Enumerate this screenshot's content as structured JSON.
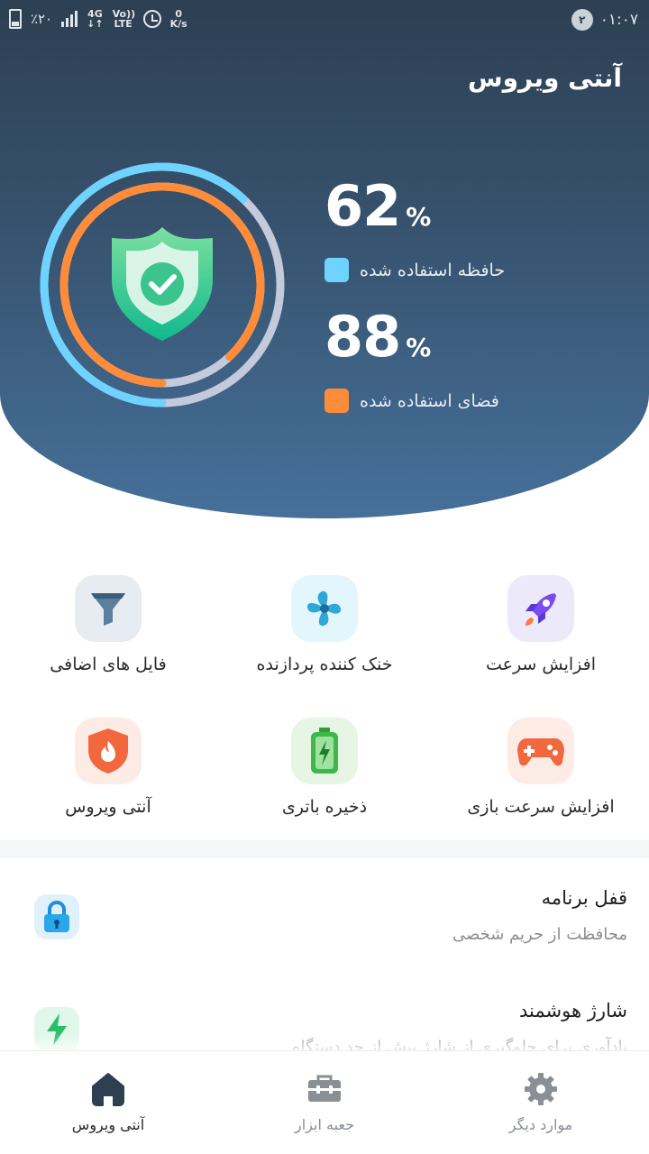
{
  "status_bar": {
    "battery_percent": "٪۲۰",
    "network_type": "4G",
    "volte": "Vo)) LTE",
    "speed_value": "0",
    "speed_unit": "K/s",
    "notification_count": "۲",
    "time": "۰۱:۰۷"
  },
  "header": {
    "title": "آنتی ویروس"
  },
  "stats": {
    "memory": {
      "value": "62",
      "unit": "%",
      "label": "حافظه استفاده شده",
      "color": "#6fd3ff",
      "fraction": 0.62
    },
    "storage": {
      "value": "88",
      "unit": "%",
      "label": "فضای استفاده شده",
      "color": "#ff8c3a",
      "fraction": 0.88
    }
  },
  "tools": [
    {
      "label": "افزایش سرعت",
      "icon": "rocket-icon"
    },
    {
      "label": "خنک کننده پردازنده",
      "icon": "fan-icon"
    },
    {
      "label": "فایل های اضافی",
      "icon": "funnel-icon"
    },
    {
      "label": "افزایش سرعت بازی",
      "icon": "gamepad-icon"
    },
    {
      "label": "ذخیره باتری",
      "icon": "battery-icon"
    },
    {
      "label": "آنتی ویروس",
      "icon": "shield-icon"
    }
  ],
  "list": [
    {
      "title": "قفل برنامه",
      "subtitle": "محافظت از حریم شخصی",
      "icon": "lock-icon"
    },
    {
      "title": "شارژ هوشمند",
      "subtitle": "یادآوری برای جلوگیری از شارژ بیش از حد دستگاه",
      "icon": "bolt-icon"
    }
  ],
  "bottom_nav": [
    {
      "label": "موارد دیگر",
      "icon": "gear-icon",
      "active": false
    },
    {
      "label": "جعبه ابزار",
      "icon": "toolbox-icon",
      "active": false
    },
    {
      "label": "آنتی ویروس",
      "icon": "home-icon",
      "active": true
    }
  ],
  "colors": {
    "accent_dark": "#2d3f52",
    "nav_active": "#2f3f52",
    "nav_inactive": "#8a8f96"
  }
}
